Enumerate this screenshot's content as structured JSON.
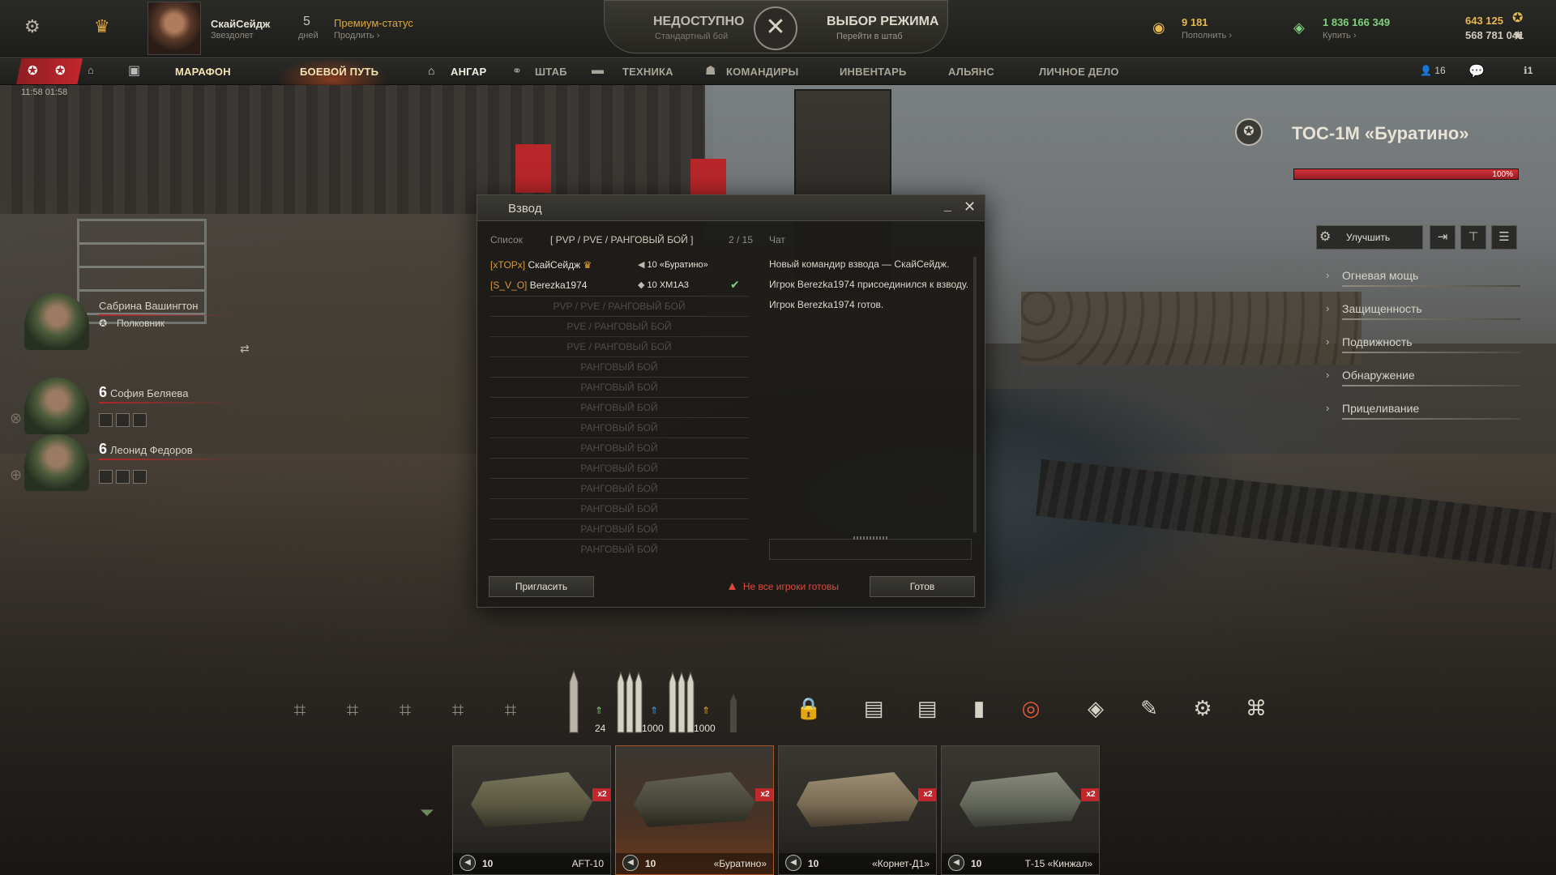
{
  "header": {
    "player_name": "СкайСейдж",
    "player_rank": "Звездолет",
    "premium_days": "5",
    "premium_days_label": "дней",
    "premium_title": "Премиум-статус",
    "premium_extend": "Продлить",
    "mode_left_title": "НЕДОСТУПНО",
    "mode_left_sub": "Стандартный бой",
    "mode_right_title": "ВЫБОР РЕЖИМА",
    "mode_right_sub": "Перейти в штаб",
    "gold": "9 181",
    "gold_action": "Пополнить",
    "credits": "1 836 166 349",
    "credits_action": "Купить",
    "bonds": "643 125",
    "free_xp": "568 781 041"
  },
  "nav": {
    "items": [
      "МАРАФОН",
      "БОЕВОЙ ПУТЬ",
      "АНГАР",
      "ШТАБ",
      "ТЕХНИКА",
      "КОМАНДИРЫ",
      "ИНВЕНТАРЬ",
      "АЛЬЯНС",
      "ЛИЧНОЕ ДЕЛО"
    ],
    "active": "АНГАР",
    "clock": "11:58 01:58",
    "friends_count": "16",
    "notifications": "1"
  },
  "crew": [
    {
      "level": "",
      "name": "Сабрина Вашингтон",
      "rank": "Полковник"
    },
    {
      "level": "6",
      "name": "София Беляева"
    },
    {
      "level": "6",
      "name": "Леонид Федоров"
    }
  ],
  "vehicle": {
    "name": "ТОС-1М «Буратино»",
    "hp_percent": "100%",
    "upgrade_label": "Улучшить",
    "stats": [
      "Огневая мощь",
      "Защищенность",
      "Подвижность",
      "Обнаружение",
      "Прицеливание"
    ]
  },
  "platoon": {
    "title": "Взвод",
    "list_tab": "Список",
    "filter": "[ PVP / PVE / РАНГОВЫЙ БОЙ ]",
    "count": "2 / 15",
    "chat_tab": "Чат",
    "members": [
      {
        "clan": "[xTOPx]",
        "name": "СкайСейдж",
        "vehicle": "10 «Буратино»",
        "ready": false
      },
      {
        "clan": "[S_V_O]",
        "name": "Berezka1974",
        "vehicle": "10 XM1A3",
        "ready": true
      }
    ],
    "empty_slots": [
      "PVP / PVE / РАНГОВЫЙ БОЙ",
      "PVE / РАНГОВЫЙ БОЙ",
      "PVE / РАНГОВЫЙ БОЙ",
      "РАНГОВЫЙ БОЙ",
      "РАНГОВЫЙ БОЙ",
      "РАНГОВЫЙ БОЙ",
      "РАНГОВЫЙ БОЙ",
      "РАНГОВЫЙ БОЙ",
      "РАНГОВЫЙ БОЙ",
      "РАНГОВЫЙ БОЙ",
      "РАНГОВЫЙ БОЙ",
      "РАНГОВЫЙ БОЙ",
      "РАНГОВЫЙ БОЙ"
    ],
    "chat": [
      "Новый командир взвода — СкайСейдж.",
      "Игрок Berezka1974 присоединился к взводу.",
      "Игрок Berezka1974 готов."
    ],
    "invite_label": "Пригласить",
    "warning": "Не все игроки готовы",
    "ready_label": "Готов"
  },
  "ammo": {
    "shell_1": "24",
    "shell_2": "1000",
    "shell_3": "1000"
  },
  "carousel": [
    {
      "tier": "10",
      "name": "AFT-10",
      "badge": "x2"
    },
    {
      "tier": "10",
      "name": "«Буратино»",
      "badge": "x2",
      "selected": true
    },
    {
      "tier": "10",
      "name": "«Корнет-Д1»",
      "badge": "x2"
    },
    {
      "tier": "10",
      "name": "Т-15 «Кинжал»",
      "badge": "x2"
    }
  ],
  "colors": {
    "accent_red": "#c0282e",
    "gold": "#e7b84a",
    "credits": "#7ed27a",
    "ready_green": "#7ed27a"
  }
}
